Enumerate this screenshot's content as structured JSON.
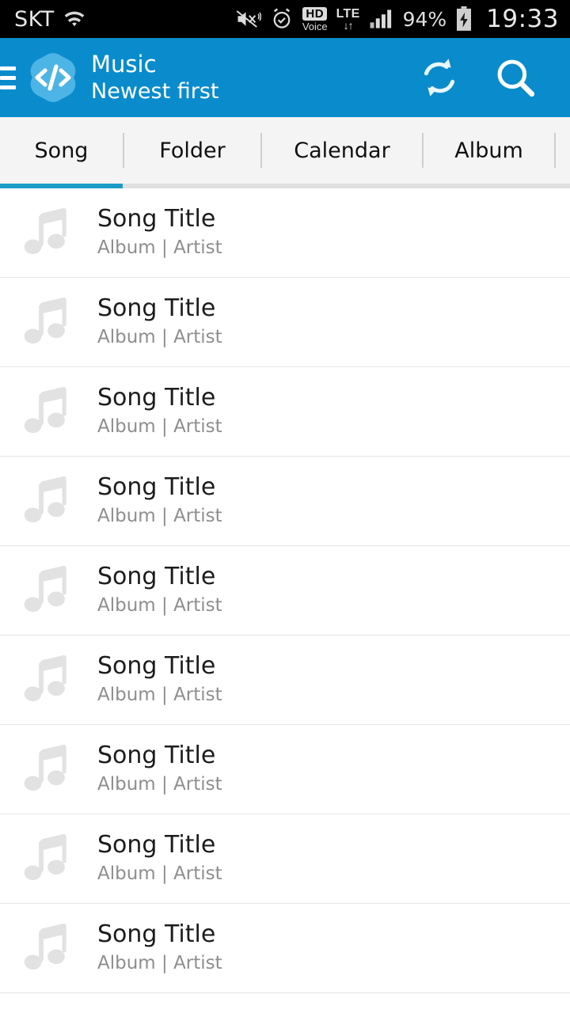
{
  "status_bar": {
    "carrier": "SKT",
    "time": "19:33",
    "battery_percent": "94%",
    "hd_label": "HD",
    "voice_label": "Voice",
    "network_label": "LTE",
    "icons": {
      "wifi": "wifi-icon",
      "mute_vibrate": "mute-vibrate-icon",
      "alarm": "alarm-clock-icon",
      "hd_voice": "hd-voice-icon",
      "lte_data": "lte-data-arrows-icon",
      "signal": "cellular-signal-icon",
      "battery": "battery-charging-icon"
    },
    "background": "#000000",
    "foreground": "#e8e8e8"
  },
  "app_bar": {
    "title": "Music",
    "subtitle": "Newest first",
    "menu_icon": "hamburger-menu-icon",
    "logo_icon": "code-brackets-logo-icon",
    "sort_caret_icon": "sort-caret-icon",
    "refresh_icon": "refresh-sync-icon",
    "search_icon": "search-icon",
    "background": "#0a8ccc",
    "logo_color": "#4db4e6"
  },
  "tabs": {
    "items": [
      {
        "label": "Song",
        "active": true
      },
      {
        "label": "Folder",
        "active": false
      },
      {
        "label": "Calendar",
        "active": false
      },
      {
        "label": "Album",
        "active": false
      }
    ],
    "indicator_color": "#1a9cc7",
    "background": "#f4f4f4"
  },
  "song_list": {
    "item_icon": "music-note-icon",
    "rows": [
      {
        "title": "Song Title",
        "subtitle": "Album | Artist"
      },
      {
        "title": "Song Title",
        "subtitle": "Album | Artist"
      },
      {
        "title": "Song Title",
        "subtitle": "Album | Artist"
      },
      {
        "title": "Song Title",
        "subtitle": "Album | Artist"
      },
      {
        "title": "Song Title",
        "subtitle": "Album | Artist"
      },
      {
        "title": "Song Title",
        "subtitle": "Album | Artist"
      },
      {
        "title": "Song Title",
        "subtitle": "Album | Artist"
      },
      {
        "title": "Song Title",
        "subtitle": "Album | Artist"
      },
      {
        "title": "Song Title",
        "subtitle": "Album | Artist"
      }
    ]
  }
}
